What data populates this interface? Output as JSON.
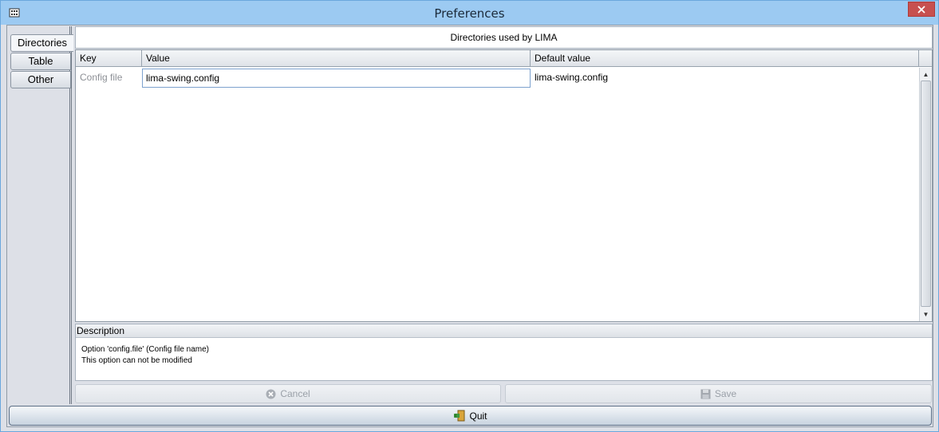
{
  "window": {
    "title": "Preferences"
  },
  "tabs": [
    {
      "label": "Directories",
      "active": true
    },
    {
      "label": "Table",
      "active": false
    },
    {
      "label": "Other",
      "active": false
    }
  ],
  "panel": {
    "header": "Directories used by LIMA"
  },
  "table": {
    "columns": [
      "Key",
      "Value",
      "Default value"
    ],
    "rows": [
      {
        "key": "Config file",
        "value": "lima-swing.config",
        "default": "lima-swing.config"
      }
    ]
  },
  "description": {
    "title": "Description",
    "lines": [
      "Option 'config.file' (Config file name)",
      "This option can not be modified"
    ]
  },
  "buttons": {
    "cancel": "Cancel",
    "save": "Save",
    "quit": "Quit"
  },
  "colors": {
    "titlebar": "#9ccaf2",
    "close": "#c7504f",
    "selection_border": "#7da2ce"
  },
  "icons": {
    "app": "java-cup-icon",
    "close": "close-icon",
    "cancel": "cancel-icon",
    "save": "floppy-disk-icon",
    "quit": "exit-door-icon"
  }
}
